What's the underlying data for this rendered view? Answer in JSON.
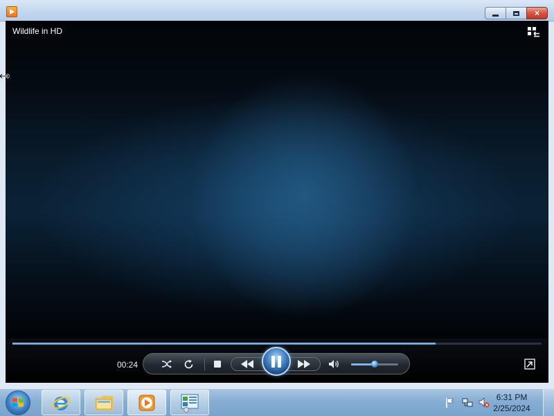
{
  "window": {
    "minimize_glyph": "minimize",
    "maximize_glyph": "maximize",
    "close_glyph": "×"
  },
  "video": {
    "title": "Wildlife in HD",
    "switch_to_library_icon": "switch-to-library-icon"
  },
  "playback": {
    "elapsed_time": "00:24",
    "progress_fraction": 0.8,
    "state": "playing",
    "volume_fraction": 0.5
  },
  "controls": {
    "shuffle_icon": "shuffle-icon",
    "repeat_icon": "repeat-icon",
    "stop_icon": "stop-icon",
    "previous_icon": "previous-icon",
    "pause_icon": "pause-icon",
    "next_icon": "next-icon",
    "mute_icon": "speaker-icon",
    "fullscreen_icon": "fullscreen-icon"
  },
  "taskbar": {
    "start_icon": "windows-start-icon",
    "pinned": [
      {
        "name": "internet-explorer-icon",
        "active": false
      },
      {
        "name": "windows-explorer-icon",
        "active": false
      },
      {
        "name": "windows-media-player-icon",
        "active": true
      },
      {
        "name": "control-panel-icon",
        "active": false
      }
    ],
    "tray_icons": [
      "action-center-flag-icon",
      "network-icon",
      "volume-muted-icon"
    ],
    "time": "6:31 PM",
    "date": "2/25/2024"
  },
  "colors": {
    "accent": "#4f86c6",
    "titlebar": "#c2d6ee",
    "close_button": "#c0392b",
    "taskbar": "#86aed4"
  }
}
